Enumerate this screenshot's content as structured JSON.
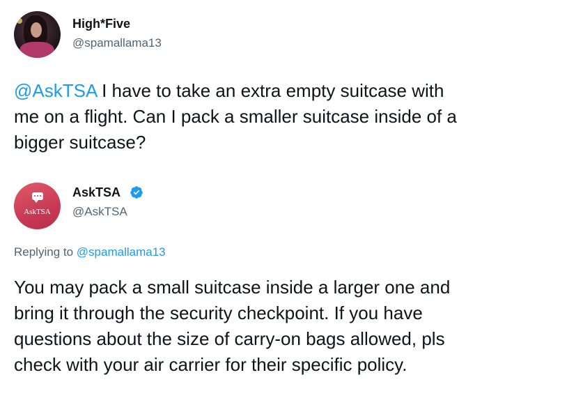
{
  "tweet1": {
    "author_name": "High*Five",
    "author_handle": "@spamallama13",
    "mention": "@AskTSA",
    "text_line1_rest": " I have to take an extra empty suitcase with",
    "text_line2": "me on a flight. Can I pack a smaller suitcase inside of a",
    "text_line3": "bigger suitcase?",
    "avatar_icon": "profile-photo"
  },
  "tweet2": {
    "author_name": "AskTSA",
    "author_handle": "@AskTSA",
    "verified_icon": "verified-badge-icon",
    "avatar_text": "AskTSA",
    "replying_prefix": "Replying to ",
    "replying_handle": "@spamallama13",
    "text_lines": [
      "You may pack a small suitcase inside a larger one and",
      "bring it through the security checkpoint. If you have",
      "questions about the size of carry-on bags allowed, pls",
      "check with your air carrier for their specific policy."
    ]
  },
  "colors": {
    "mention": "#1d9bf0",
    "verified": "#1d9bf0",
    "secondary_text": "#536471",
    "tsa_avatar": "#c83a55"
  }
}
